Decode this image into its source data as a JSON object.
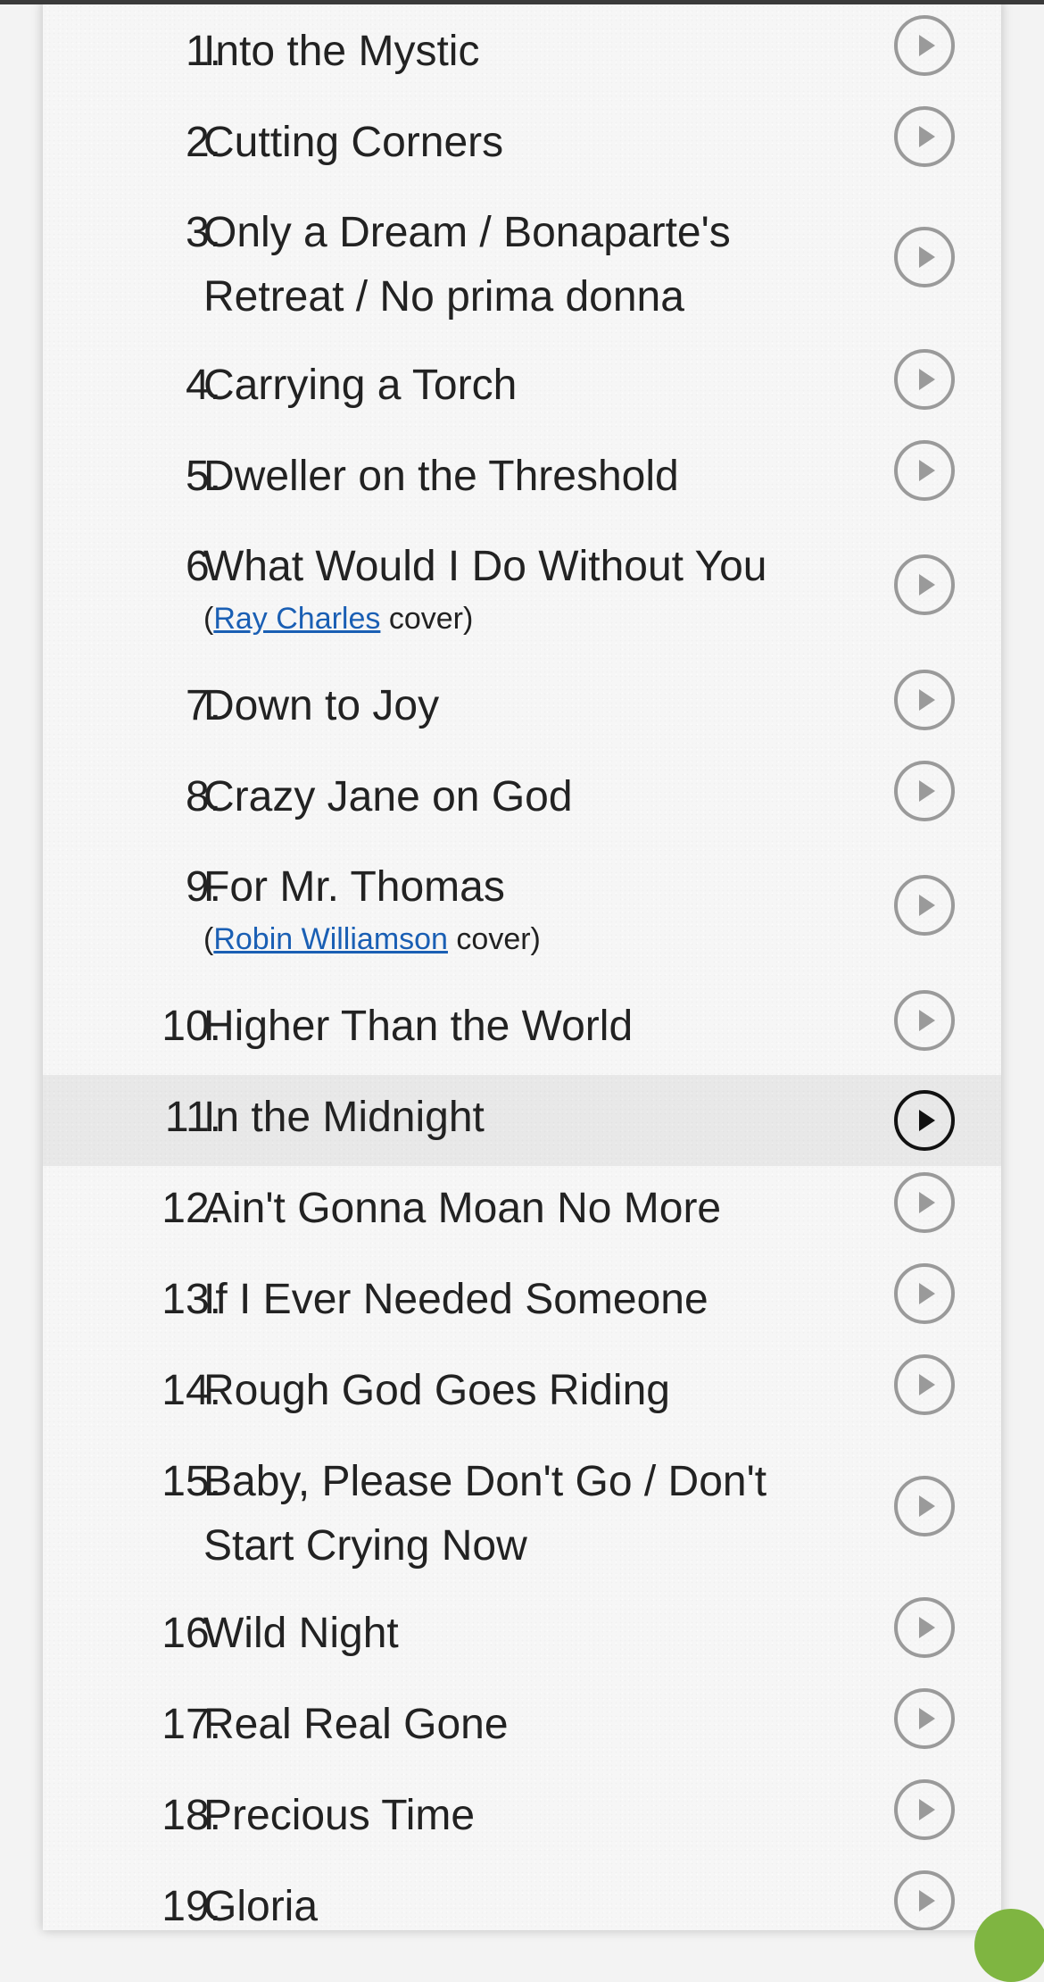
{
  "tracklist": {
    "items": [
      {
        "number": "1.",
        "lines": [
          "Into the Mystic"
        ]
      },
      {
        "number": "2.",
        "lines": [
          "Cutting Corners"
        ]
      },
      {
        "number": "3.",
        "lines": [
          "Only a Dream / Bonaparte's",
          "Retreat / No prima donna"
        ]
      },
      {
        "number": "4.",
        "lines": [
          "Carrying a Torch"
        ]
      },
      {
        "number": "5.",
        "lines": [
          "Dweller on the Threshold"
        ]
      },
      {
        "number": "6.",
        "lines": [
          "What Would I Do Without You"
        ],
        "cover": {
          "open": "(",
          "artist": "Ray Charles",
          "suffix": " cover)"
        }
      },
      {
        "number": "7.",
        "lines": [
          "Down to Joy"
        ]
      },
      {
        "number": "8.",
        "lines": [
          "Crazy Jane on God"
        ]
      },
      {
        "number": "9.",
        "lines": [
          "For Mr. Thomas"
        ],
        "cover": {
          "open": "(",
          "artist": "Robin Williamson",
          "suffix": " cover)"
        }
      },
      {
        "number": "10.",
        "lines": [
          "Higher Than the World"
        ]
      },
      {
        "number": "11.",
        "lines": [
          "In the Midnight"
        ],
        "active": true
      },
      {
        "number": "12.",
        "lines": [
          "Ain't Gonna Moan No More"
        ]
      },
      {
        "number": "13.",
        "lines": [
          "If I Ever Needed Someone"
        ]
      },
      {
        "number": "14.",
        "lines": [
          "Rough God Goes Riding"
        ]
      },
      {
        "number": "15.",
        "lines": [
          "Baby, Please Don't Go / Don't",
          "Start Crying Now"
        ]
      },
      {
        "number": "16.",
        "lines": [
          "Wild Night"
        ]
      },
      {
        "number": "17.",
        "lines": [
          "Real Real Gone"
        ]
      },
      {
        "number": "18.",
        "lines": [
          "Precious Time"
        ]
      },
      {
        "number": "19.",
        "lines": [
          "Gloria"
        ]
      }
    ]
  },
  "icons": {
    "play": "play-circle-icon"
  },
  "colors": {
    "link": "#1a5fb4",
    "active_row": "#ebebeb",
    "icon_idle": "#9a9a9a",
    "icon_active": "#111111",
    "badge": "#7fb541"
  }
}
